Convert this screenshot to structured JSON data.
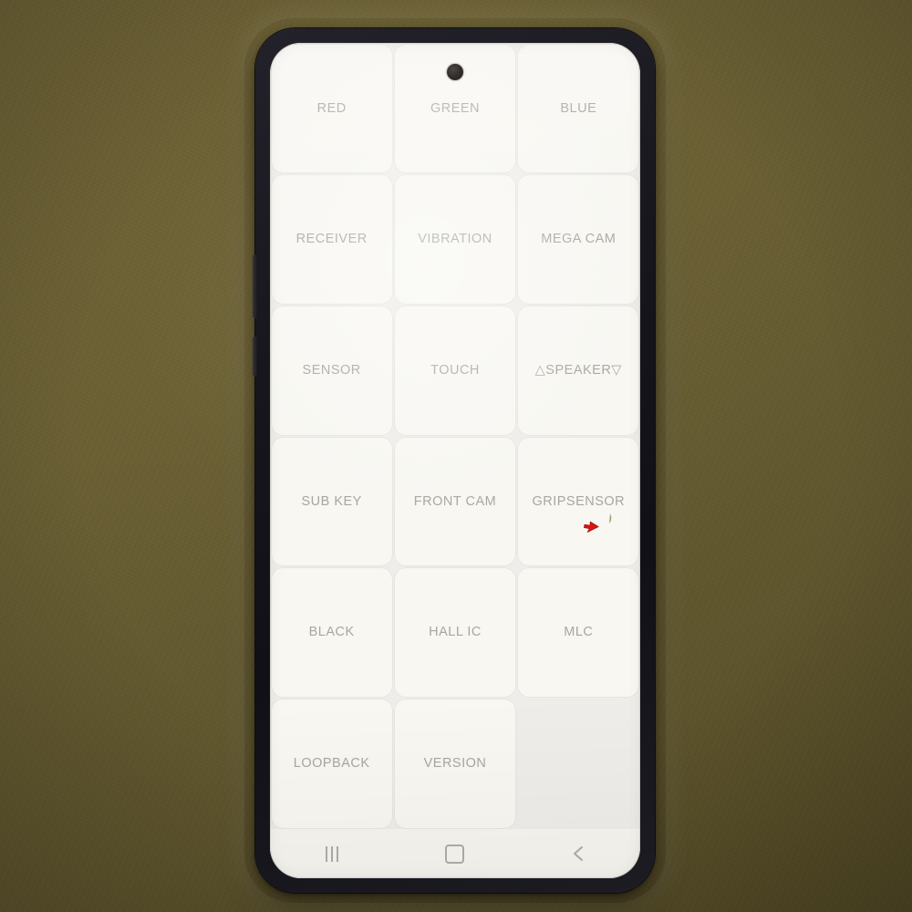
{
  "device": {
    "name": "smartphone",
    "frame_color": "#17161c",
    "screen_background": "#f4f3ee",
    "punch_hole_camera": "front-camera-punch-hole"
  },
  "scene": {
    "background_color": "#6b5f33",
    "description": "olive desk surface"
  },
  "app": {
    "name": "factory-test-menu",
    "grid": {
      "columns": 3,
      "rows": 6,
      "label_color": "#a9a69f",
      "tile_color": "#f8f7f2",
      "items": [
        {
          "label": "RED",
          "name": "red"
        },
        {
          "label": "GREEN",
          "name": "green"
        },
        {
          "label": "BLUE",
          "name": "blue"
        },
        {
          "label": "RECEIVER",
          "name": "receiver"
        },
        {
          "label": "VIBRATION",
          "name": "vibration"
        },
        {
          "label": "MEGA CAM",
          "name": "mega-cam"
        },
        {
          "label": "SENSOR",
          "name": "sensor"
        },
        {
          "label": "TOUCH",
          "name": "touch"
        },
        {
          "label": "△SPEAKER▽",
          "name": "speaker"
        },
        {
          "label": "SUB KEY",
          "name": "sub-key"
        },
        {
          "label": "FRONT CAM",
          "name": "front-cam"
        },
        {
          "label": "GRIPSENSOR",
          "name": "gripsensor"
        },
        {
          "label": "BLACK",
          "name": "black"
        },
        {
          "label": "HALL IC",
          "name": "hall-ic"
        },
        {
          "label": "MLC",
          "name": "mlc"
        },
        {
          "label": "LOOPBACK",
          "name": "loopback"
        },
        {
          "label": "VERSION",
          "name": "version"
        },
        {
          "label": "",
          "name": "empty"
        }
      ]
    }
  },
  "navbar": {
    "buttons": [
      {
        "name": "recents",
        "icon": "recents-icon"
      },
      {
        "name": "home",
        "icon": "home-icon"
      },
      {
        "name": "back",
        "icon": "back-chevron-icon"
      }
    ]
  },
  "cursor": {
    "name": "mouse-pointer",
    "color": "#d81414",
    "over_tile": "GRIPSENSOR"
  }
}
